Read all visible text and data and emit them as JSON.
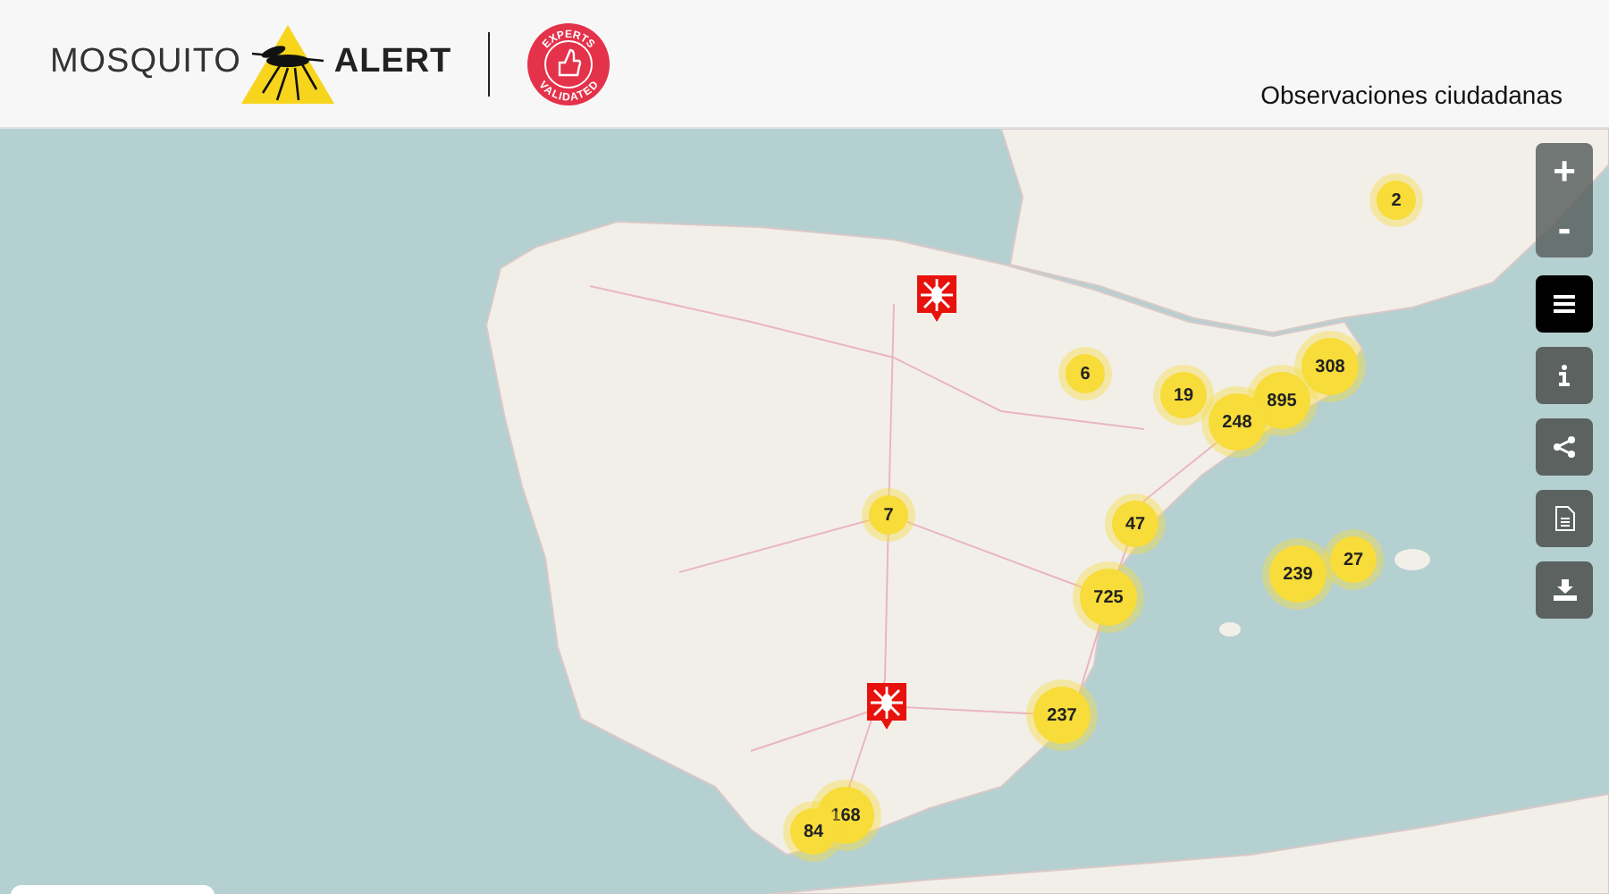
{
  "header": {
    "logo_left": "MOSQUITO",
    "logo_right": "ALERT",
    "badge_top": "EXPERTS",
    "badge_bottom": "VALIDATED",
    "subtitle": "Observaciones ciudadanas"
  },
  "zoom": {
    "in": "+",
    "out": "-"
  },
  "tools": [
    {
      "kind": "menu",
      "selected": true
    },
    {
      "kind": "info",
      "selected": false
    },
    {
      "kind": "share",
      "selected": false
    },
    {
      "kind": "report",
      "selected": false
    },
    {
      "kind": "download",
      "selected": false
    }
  ],
  "clusters": [
    {
      "count": "2"
    },
    {
      "count": "6"
    },
    {
      "count": "19"
    },
    {
      "count": "308"
    },
    {
      "count": "895"
    },
    {
      "count": "248"
    },
    {
      "count": "7"
    },
    {
      "count": "47"
    },
    {
      "count": "239"
    },
    {
      "count": "27"
    },
    {
      "count": "725"
    },
    {
      "count": "237"
    },
    {
      "count": "168"
    },
    {
      "count": "84"
    }
  ],
  "markers": [
    {
      "kind": "validated"
    },
    {
      "kind": "validated"
    }
  ]
}
